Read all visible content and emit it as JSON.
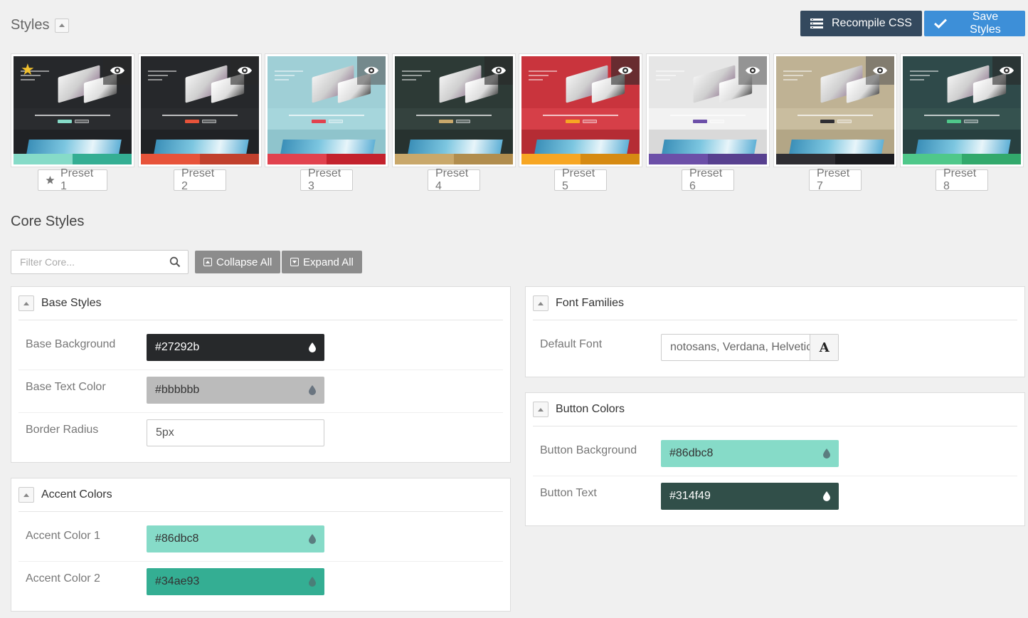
{
  "header": {
    "title": "Styles",
    "recompile_label": "Recompile CSS",
    "save_label": "Save Styles"
  },
  "presets": [
    {
      "label": "Preset 1",
      "active": true,
      "hero": "#26282b",
      "mid": "#2a2c2f",
      "low": "#202225",
      "c1": "#86dbc8",
      "c2": "#34ae93",
      "btn": "#86dbc8"
    },
    {
      "label": "Preset 2",
      "active": false,
      "hero": "#26282b",
      "mid": "#2a2c2f",
      "low": "#202225",
      "c1": "#e7533a",
      "c2": "#c1402d",
      "btn": "#e7533a"
    },
    {
      "label": "Preset 3",
      "active": false,
      "hero": "#9fcfd6",
      "mid": "#a6d6dc",
      "low": "#8fc4cc",
      "c1": "#e1424e",
      "c2": "#c3222d",
      "btn": "#e1424e"
    },
    {
      "label": "Preset 4",
      "active": false,
      "hero": "#2d3a36",
      "mid": "#34423e",
      "low": "#27322f",
      "c1": "#c9a86b",
      "c2": "#b18d4e",
      "btn": "#c9a86b"
    },
    {
      "label": "Preset 5",
      "active": false,
      "hero": "#c9343d",
      "mid": "#d63f48",
      "low": "#b52c34",
      "c1": "#f7a623",
      "c2": "#d68a12",
      "btn": "#f7a623"
    },
    {
      "label": "Preset 6",
      "active": false,
      "hero": "#e6e6e6",
      "mid": "#f2f2f2",
      "low": "#d9d9d9",
      "c1": "#6c4fa8",
      "c2": "#57408f",
      "btn": "#6c4fa8"
    },
    {
      "label": "Preset 7",
      "active": false,
      "hero": "#bfb294",
      "mid": "#c9bd9f",
      "low": "#b3a686",
      "c1": "#2f2e33",
      "c2": "#1b1b1f",
      "btn": "#2f2e33"
    },
    {
      "label": "Preset 8",
      "active": false,
      "hero": "#2f4a4a",
      "mid": "#35524f",
      "low": "#284040",
      "c1": "#4fc88a",
      "c2": "#32a96c",
      "btn": "#4fc88a"
    }
  ],
  "core": {
    "title": "Core Styles",
    "filter_placeholder": "Filter Core...",
    "collapse_all": "Collapse All",
    "expand_all": "Expand All"
  },
  "base_styles": {
    "title": "Base Styles",
    "rows": [
      {
        "label": "Base Background",
        "value": "#27292b",
        "bg": "#27292b",
        "fg": "#ffffff"
      },
      {
        "label": "Base Text Color",
        "value": "#bbbbbb",
        "bg": "#bbbbbb",
        "fg": "#333333"
      },
      {
        "label": "Border Radius",
        "value": "5px"
      }
    ]
  },
  "accent_colors": {
    "title": "Accent Colors",
    "rows": [
      {
        "label": "Accent Color 1",
        "value": "#86dbc8",
        "bg": "#86dbc8",
        "fg": "#333333"
      },
      {
        "label": "Accent Color 2",
        "value": "#34ae93",
        "bg": "#34ae93",
        "fg": "#333333"
      }
    ]
  },
  "font_families": {
    "title": "Font Families",
    "rows": [
      {
        "label": "Default Font",
        "value": "notosans, Verdana, Helvetica",
        "button": "A"
      }
    ]
  },
  "button_colors": {
    "title": "Button Colors",
    "rows": [
      {
        "label": "Button Background",
        "value": "#86dbc8",
        "bg": "#86dbc8",
        "fg": "#333333"
      },
      {
        "label": "Button Text",
        "value": "#314f49",
        "bg": "#314f49",
        "fg": "#ffffff"
      }
    ]
  },
  "colors": {
    "recompile": "#34495e",
    "save": "#3d8fd8",
    "gray_button": "#8c8c8c"
  }
}
